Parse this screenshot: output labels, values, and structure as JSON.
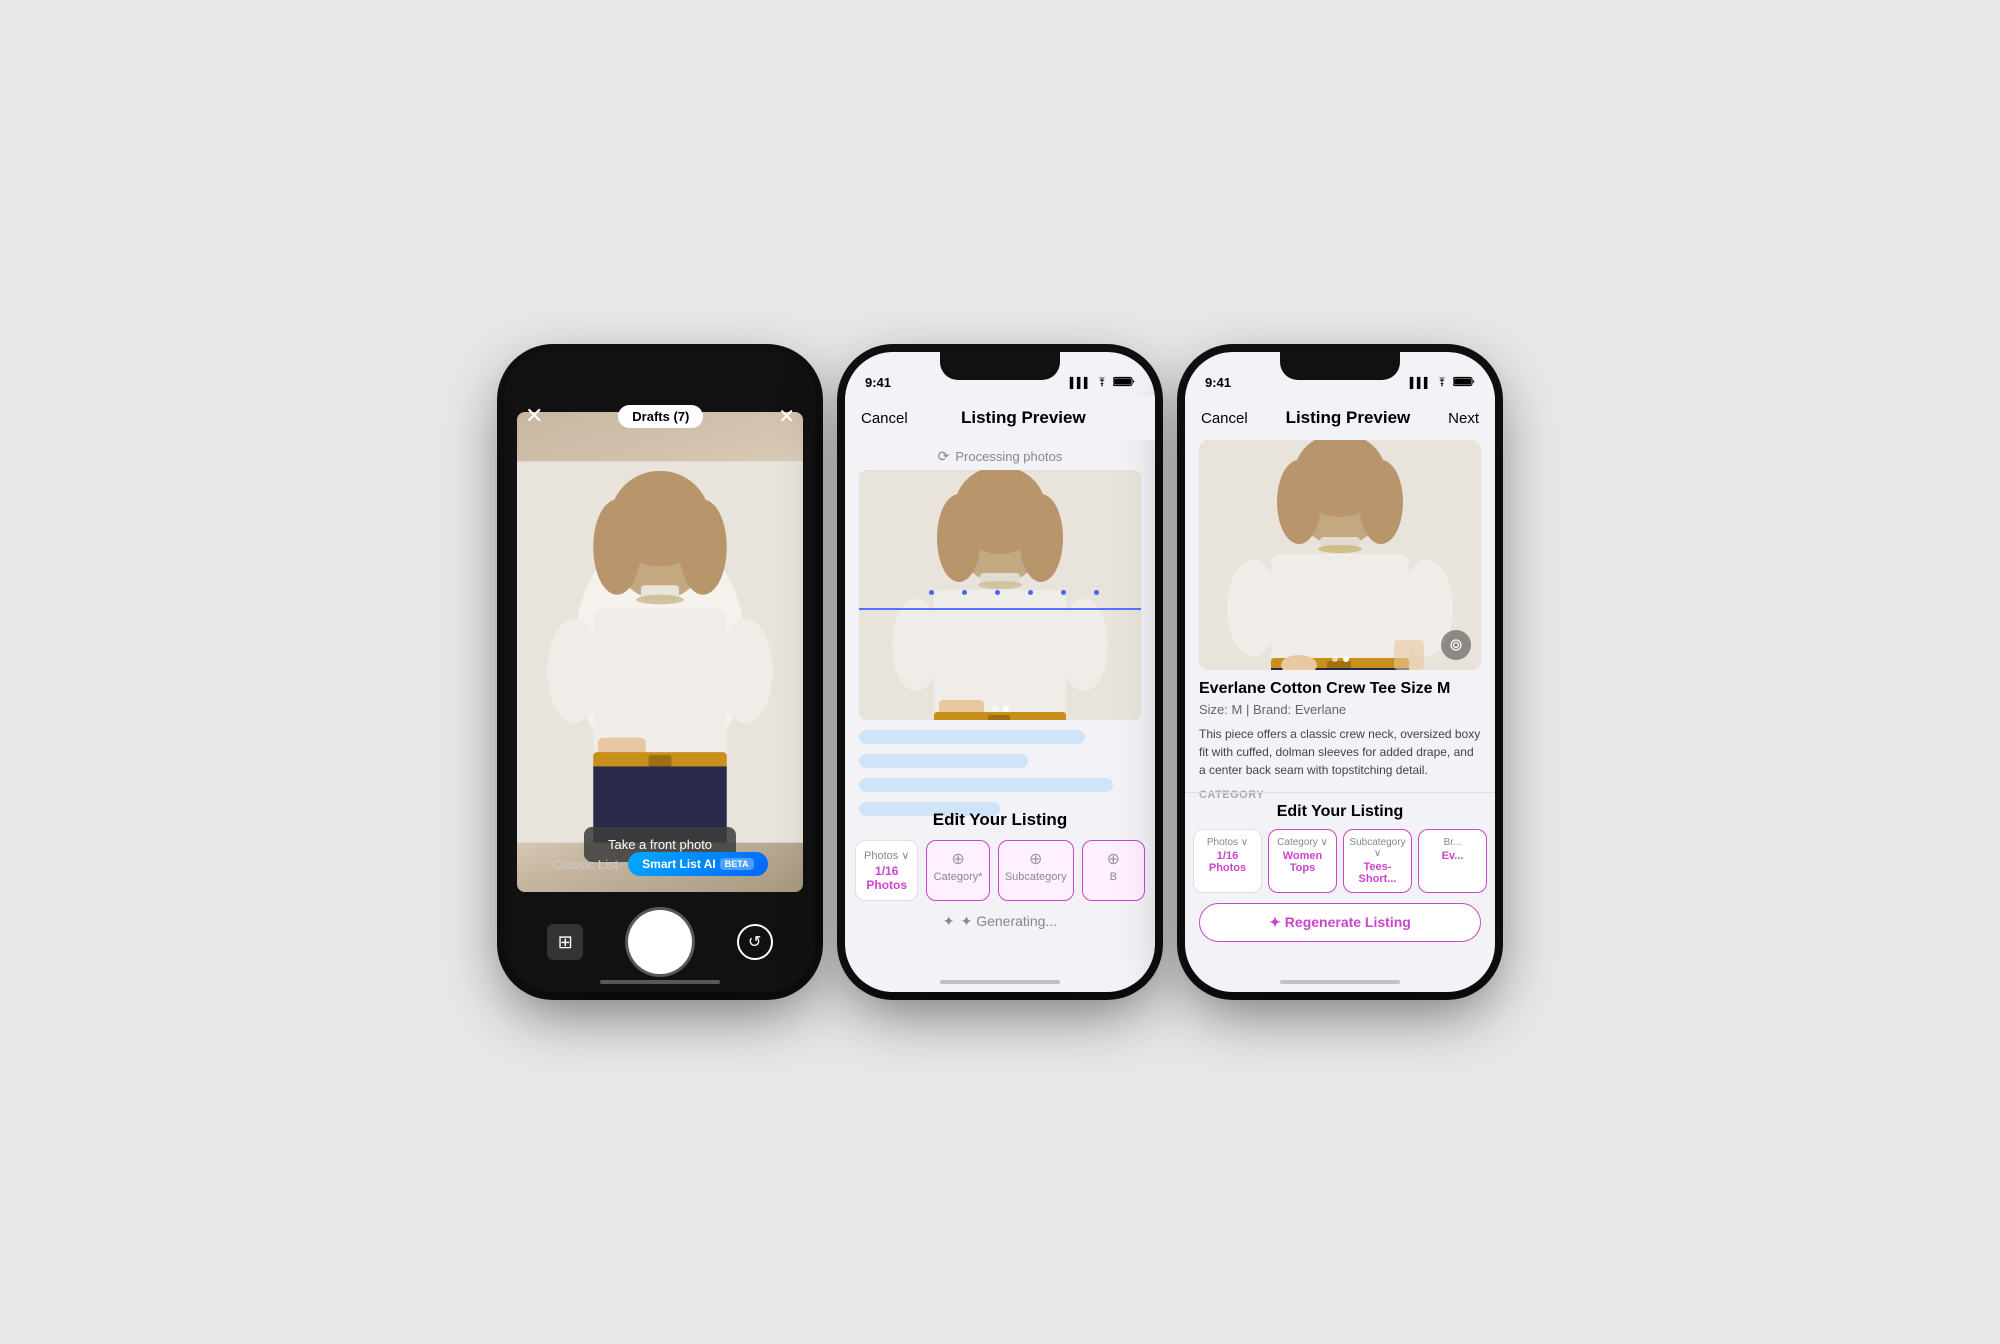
{
  "phones": {
    "phone1": {
      "topBar": {
        "closeIcon": "✕",
        "draftsLabel": "Drafts (7)",
        "flashIcon": "✕"
      },
      "cameraOverlay": {
        "instructionText": "Take a front photo"
      },
      "listingTypeBar": {
        "classicLabel": "Classic List",
        "smartLabel": "Smart List AI",
        "betaBadge": "BETA"
      },
      "bottomBar": {
        "galleryIcon": "🖼",
        "flipIcon": "↺"
      }
    },
    "phone2": {
      "statusBar": {
        "time": "9:41",
        "signal": "▌▌▌",
        "wifi": "WiFi",
        "battery": "🔋"
      },
      "navBar": {
        "cancelLabel": "Cancel",
        "titleLabel": "Listing Preview",
        "nextLabel": ""
      },
      "processingBanner": {
        "icon": "⟳",
        "text": "Processing photos"
      },
      "imageIndicators": [
        "dot1",
        "dot2"
      ],
      "editSection": {
        "title": "Edit Your Listing",
        "tabs": [
          {
            "label": "Photos",
            "value": "1/16 Photos",
            "type": "value"
          },
          {
            "label": "Category*",
            "value": "",
            "type": "icon",
            "icon": "⊕"
          },
          {
            "label": "Subcategory",
            "value": "",
            "type": "icon",
            "icon": "⊕"
          },
          {
            "label": "B",
            "value": "",
            "type": "icon",
            "icon": "⊕"
          }
        ]
      },
      "generatingText": "✦ Generating..."
    },
    "phone3": {
      "statusBar": {
        "time": "9:41",
        "signal": "▌▌▌",
        "wifi": "WiFi",
        "battery": "🔋"
      },
      "navBar": {
        "cancelLabel": "Cancel",
        "titleLabel": "Listing Preview",
        "nextLabel": "Next"
      },
      "listing": {
        "title": "Everlane Cotton Crew Tee Size M",
        "meta": "Size: M | Brand: Everlane",
        "description": "This piece offers a classic crew neck, oversized boxy fit with cuffed, dolman sleeves for added drape, and a center back seam with topstitching detail.",
        "categoryLabel": "CATEGORY"
      },
      "editSection": {
        "title": "Edit Your Listing",
        "tabs": [
          {
            "label": "Photos",
            "value": "1/16 Photos"
          },
          {
            "label": "Category",
            "value": "Women Tops"
          },
          {
            "label": "Subcategory",
            "value": "Tees- Short..."
          },
          {
            "label": "Br...",
            "value": "Ev..."
          }
        ]
      },
      "regenerateBtn": "✦ Regenerate Listing"
    }
  }
}
